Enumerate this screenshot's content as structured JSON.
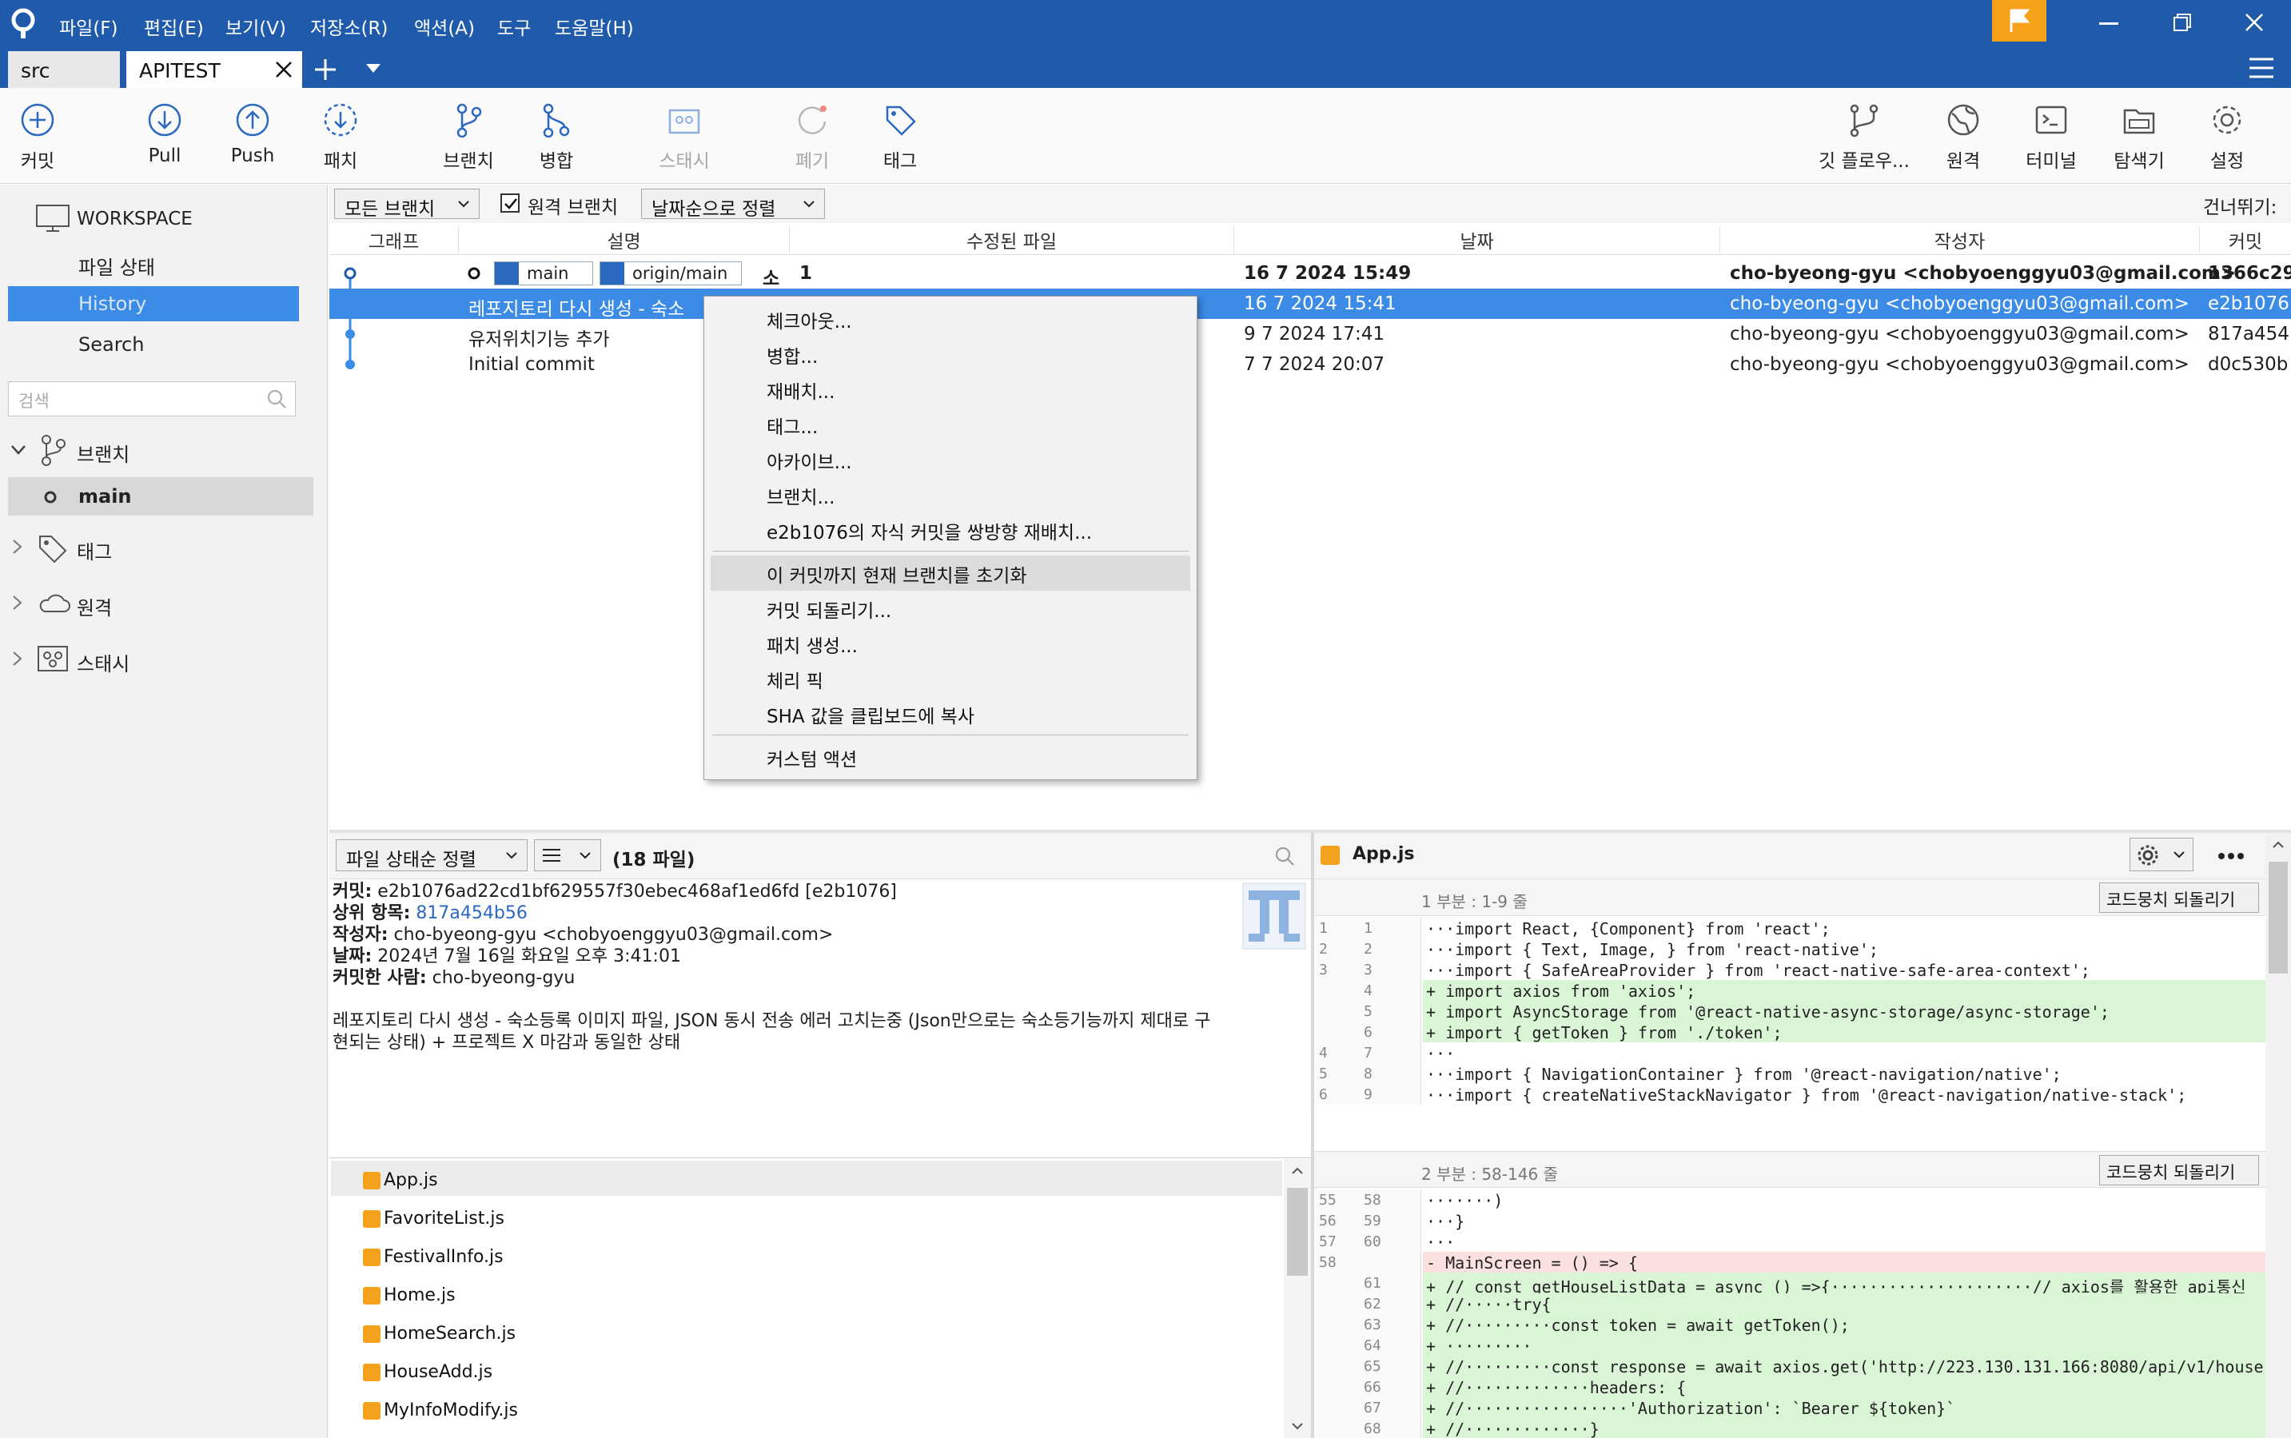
{
  "menu": [
    "파일(F)",
    "편집(E)",
    "보기(V)",
    "저장소(R)",
    "액션(A)",
    "도구",
    "도움말(H)"
  ],
  "tabs": [
    {
      "label": "src"
    },
    {
      "label": "APITEST"
    }
  ],
  "toolbar": {
    "commit": "커밋",
    "pull": "Pull",
    "push": "Push",
    "patch": "패치",
    "branch": "브랜치",
    "merge": "병합",
    "stash": "스태시",
    "discard": "폐기",
    "tag": "태그",
    "gitflow": "깃 플로우...",
    "remote": "원격",
    "terminal": "터미널",
    "explorer": "탐색기",
    "settings": "설정"
  },
  "sidebar": {
    "workspace": "WORKSPACE",
    "file_status": "파일 상태",
    "history": "History",
    "search": "Search",
    "search_placeholder": "검색",
    "branches": "브랜치",
    "branch_main": "main",
    "tags": "태그",
    "remotes": "원격",
    "stashes": "스태시"
  },
  "filter": {
    "all_branches": "모든 브랜치",
    "remote_branches": "원격 브랜치",
    "sort": "날짜순으로 정렬",
    "skip": "건너뛰기:"
  },
  "columns": [
    "그래프",
    "설명",
    "수정된 파일",
    "날짜",
    "작성자",
    "커밋"
  ],
  "commits": [
    {
      "badge_local": "main",
      "badge_remote": "origin/main",
      "desc": "소",
      "files": "1",
      "date": "16 7 2024 15:49",
      "author": "cho-byeong-gyu <chobyoenggyu03@gmail.com>",
      "hash": "1366c29"
    },
    {
      "desc": "레포지토리 다시 생성 - 숙소",
      "date": "16 7 2024 15:41",
      "author": "cho-byeong-gyu <chobyoenggyu03@gmail.com>",
      "hash": "e2b1076"
    },
    {
      "desc": "유저위치기능 추가",
      "date": "9 7 2024 17:41",
      "author": "cho-byeong-gyu <chobyoenggyu03@gmail.com>",
      "hash": "817a454"
    },
    {
      "desc": "Initial commit",
      "date": "7 7 2024 20:07",
      "author": "cho-byeong-gyu <chobyoenggyu03@gmail.com>",
      "hash": "d0c530b"
    }
  ],
  "context_menu": [
    "체크아웃...",
    "병합...",
    "재배치...",
    "태그...",
    "아카이브...",
    "브랜치...",
    "e2b1076의 자식 커밋을 쌍방향 재배치...",
    "이 커밋까지 현재 브랜치를 초기화",
    "커밋 되돌리기...",
    "패치 생성...",
    "체리 픽",
    "SHA 값을 클립보드에 복사",
    "커스텀 액션"
  ],
  "details": {
    "file_sort": "파일 상태순 정렬",
    "file_count": "(18 파일)",
    "commit_label": "커밋:",
    "commit_value": "e2b1076ad22cd1bf629557f30ebec468af1ed6fd [e2b1076]",
    "parent_label": "상위 항목:",
    "parent_value": "817a454b56",
    "author_label": "작성자:",
    "author_value": "cho-byeong-gyu <chobyoenggyu03@gmail.com>",
    "date_label": "날짜:",
    "date_value": "2024년 7월 16일 화요일 오후 3:41:01",
    "committer_label": "커밋한 사람:",
    "committer_value": "cho-byeong-gyu",
    "message_line1": "레포지토리 다시 생성 - 숙소등록 이미지 파일, JSON 동시 전송 에러 고치는중 (Json만으로는 숙소등기능까지 제대로 구",
    "message_line2": "현되는 상태) + 프로젝트 X 마감과 동일한 상태"
  },
  "files": [
    "App.js",
    "FavoriteList.js",
    "FestivalInfo.js",
    "Home.js",
    "HomeSearch.js",
    "HouseAdd.js",
    "MyInfoModify.js"
  ],
  "diff": {
    "filename": "App.js",
    "hunk1_title": "1 부분 : 1-9 줄",
    "hunk2_title": "2 부분 : 58-146 줄",
    "revert": "코드뭉치 되돌리기",
    "hunk1": [
      {
        "old": "1",
        "new": "1",
        "type": "ctx",
        "text": "···import React, {Component} from 'react';"
      },
      {
        "old": "2",
        "new": "2",
        "type": "ctx",
        "text": "···import { Text, Image, } from 'react-native';"
      },
      {
        "old": "3",
        "new": "3",
        "type": "ctx",
        "text": "···import { SafeAreaProvider } from 'react-native-safe-area-context';"
      },
      {
        "old": "",
        "new": "4",
        "type": "add",
        "text": "+ import axios from 'axios';"
      },
      {
        "old": "",
        "new": "5",
        "type": "add",
        "text": "+ import AsyncStorage from '@react-native-async-storage/async-storage';"
      },
      {
        "old": "",
        "new": "6",
        "type": "add",
        "text": "+ import { getToken } from './token';"
      },
      {
        "old": "4",
        "new": "7",
        "type": "ctx",
        "text": "···"
      },
      {
        "old": "5",
        "new": "8",
        "type": "ctx",
        "text": "···import { NavigationContainer } from '@react-navigation/native';"
      },
      {
        "old": "6",
        "new": "9",
        "type": "ctx",
        "text": "···import { createNativeStackNavigator } from '@react-navigation/native-stack';"
      }
    ],
    "hunk2": [
      {
        "old": "55",
        "new": "58",
        "type": "ctx",
        "text": "·······)"
      },
      {
        "old": "56",
        "new": "59",
        "type": "ctx",
        "text": "···}"
      },
      {
        "old": "57",
        "new": "60",
        "type": "ctx",
        "text": "···"
      },
      {
        "old": "58",
        "new": "",
        "type": "del",
        "text": "- MainScreen = () => {"
      },
      {
        "old": "",
        "new": "61",
        "type": "add",
        "text": "+ // const getHouseListData = async () =>{·····················// axios를 활용한 api통신"
      },
      {
        "old": "",
        "new": "62",
        "type": "add",
        "text": "+ //·····try{"
      },
      {
        "old": "",
        "new": "63",
        "type": "add",
        "text": "+ //·········const token = await getToken();"
      },
      {
        "old": "",
        "new": "64",
        "type": "add",
        "text": "+ ·········"
      },
      {
        "old": "",
        "new": "65",
        "type": "add",
        "text": "+ //·········const response = await axios.get('http://223.130.131.166:8080/api/v1/house"
      },
      {
        "old": "",
        "new": "66",
        "type": "add",
        "text": "+ //·············headers: {"
      },
      {
        "old": "",
        "new": "67",
        "type": "add",
        "text": "+ //·················'Authorization': `Bearer ${token}`"
      },
      {
        "old": "",
        "new": "68",
        "type": "add",
        "text": "+ //·············}"
      }
    ]
  },
  "colors": {
    "titlebar": "#1f5aab",
    "selection": "#3c8ce7",
    "accent": "#f7a11a",
    "add_bg": "#d9f5d6",
    "del_bg": "#fbe0e0"
  }
}
